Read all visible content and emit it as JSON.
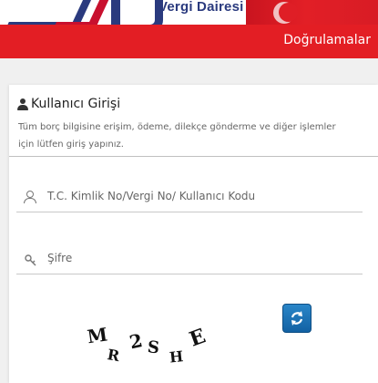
{
  "header": {
    "brand_text": "Vergi Dairesi",
    "accent_color": "#e31e24",
    "brand_color": "#2a3a7e"
  },
  "nav": {
    "link_label": "Doğrulamalar"
  },
  "login": {
    "title": "Kullanıcı Girişi",
    "description": "Tüm borç bilgisine erişim, ödeme, dilekçe gönderme ve diğer işlemler için lütfen giriş yapınız.",
    "username_placeholder": "T.C. Kimlik No/Vergi No/ Kullanıcı Kodu",
    "password_placeholder": "Şifre",
    "captcha_text": "MR2SHE",
    "refresh_icon": "refresh-icon"
  }
}
